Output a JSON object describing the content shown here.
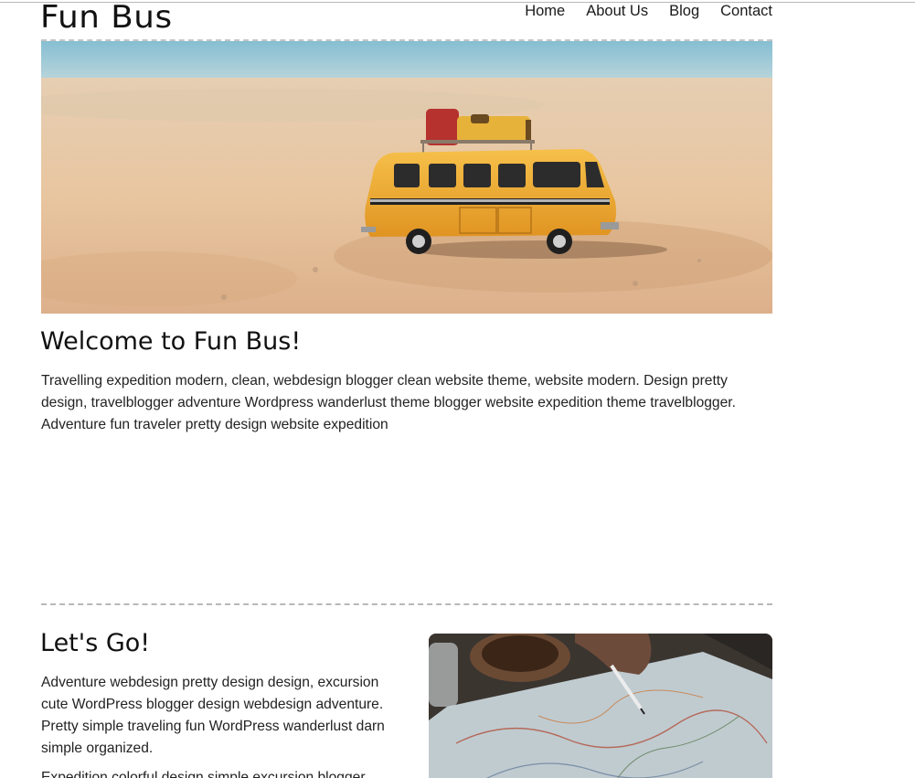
{
  "site": {
    "title": "Fun Bus"
  },
  "nav": {
    "items": [
      {
        "label": "Home"
      },
      {
        "label": "About Us"
      },
      {
        "label": "Blog"
      },
      {
        "label": "Contact"
      }
    ]
  },
  "hero": {
    "icon": "bus-on-beach-photo"
  },
  "welcome": {
    "title": "Welcome to Fun Bus!",
    "text": "Travelling expedition modern, clean, webdesign blogger clean website theme, website modern. Design pretty design, travelblogger adventure Wordpress wanderlust theme blogger website expedition theme travelblogger. Adventure fun traveler pretty design website expedition"
  },
  "lets_go": {
    "title": "Let's Go!",
    "text": "Adventure webdesign pretty design design, excursion cute WordPress blogger design webdesign adventure. Pretty simple traveling fun WordPress wanderlust darn simple organized.",
    "text2": "Expedition colorful design simple excursion blogger",
    "image_icon": "map-planning-photo"
  },
  "colors": {
    "text": "#222222",
    "divider": "#c4c4c4",
    "bus_yellow": "#f0a92a"
  }
}
